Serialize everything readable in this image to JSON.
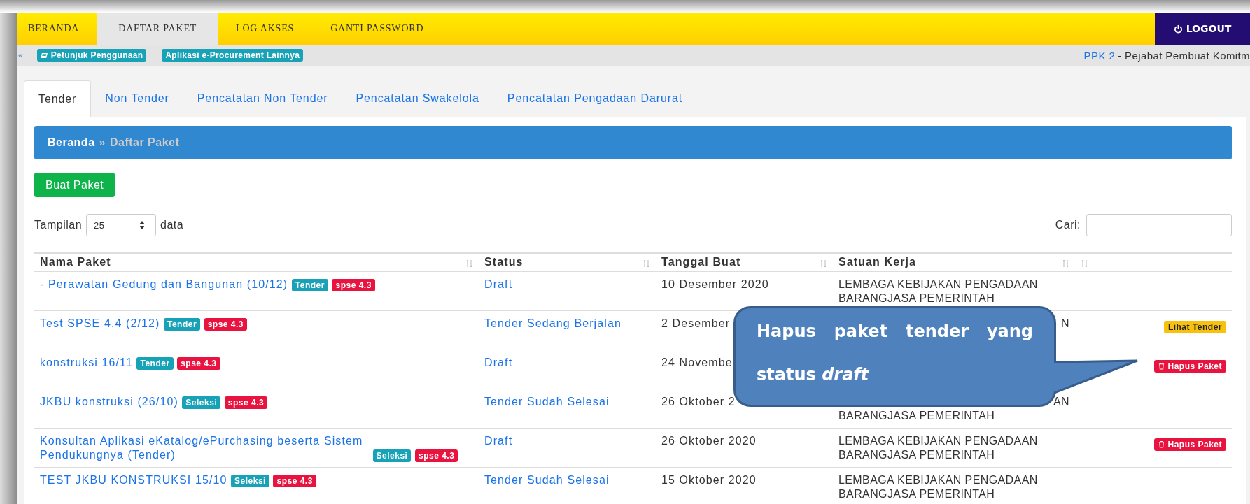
{
  "nav": {
    "items": [
      {
        "label": "BERANDA",
        "selected": false
      },
      {
        "label": "DAFTAR PAKET",
        "selected": true
      },
      {
        "label": "LOG AKSES",
        "selected": false
      },
      {
        "label": "GANTI PASSWORD",
        "selected": false
      }
    ],
    "logout": "LOGOUT"
  },
  "subbar": {
    "toggle": "«",
    "links": [
      {
        "label": "Petunjuk Penggunaan",
        "kind": "guide"
      },
      {
        "label": "Aplikasi e-Procurement Lainnya",
        "kind": "plain"
      }
    ],
    "role_link": "PPK 2",
    "role_name": "- Pejabat Pembuat Komitm"
  },
  "tabs": [
    {
      "label": "Tender",
      "selected": true
    },
    {
      "label": "Non Tender",
      "selected": false
    },
    {
      "label": "Pencatatan Non Tender",
      "selected": false
    },
    {
      "label": "Pencatatan Swakelola",
      "selected": false
    },
    {
      "label": "Pencatatan Pengadaan Darurat",
      "selected": false
    }
  ],
  "breadcrumb": {
    "home": "Beranda",
    "separator": "»",
    "current": "Daftar Paket"
  },
  "create_button": "Buat Paket",
  "page_length": {
    "label": "Tampilan",
    "value": "25",
    "suffix": "data"
  },
  "search": {
    "label": "Cari:"
  },
  "table": {
    "columns": [
      "Nama Paket",
      "Status",
      "Tanggal Buat",
      "Satuan Kerja"
    ],
    "rows": [
      {
        "name": "- Perawatan Gedung dan Bangunan (10/12)",
        "tags": [
          {
            "label": "Tender",
            "kind": "method"
          },
          {
            "label": "spse 4.3",
            "kind": "version"
          }
        ],
        "status": "Draft",
        "date": "10 Desember 2020",
        "unit": [
          {
            "text": "LEMBAGA KEBIJAKAN PENGADAAN",
            "covered": false
          },
          {
            "text": "BARANGJASA PEMERINTAH",
            "covered": false
          }
        ]
      },
      {
        "name": "Test SPSE 4.4 (2/12)",
        "tags": [
          {
            "label": "Tender",
            "kind": "method"
          },
          {
            "label": "spse 4.3",
            "kind": "version"
          }
        ],
        "status": "Tender Sedang Berjalan",
        "date": "2 Desember",
        "unit": [
          {
            "text": "N",
            "covered": true
          }
        ],
        "action": {
          "kind": "view",
          "label": "Lihat Tender"
        }
      },
      {
        "name": "konstruksi 16/11",
        "tags": [
          {
            "label": "Tender",
            "kind": "method"
          },
          {
            "label": "spse 4.3",
            "kind": "version"
          }
        ],
        "status": "Draft",
        "date": "24 Novembe",
        "unit": [],
        "action": {
          "kind": "delete",
          "label": "Hapus Paket"
        }
      },
      {
        "name": "JKBU konstruksi (26/10)",
        "tags": [
          {
            "label": "Seleksi",
            "kind": "method"
          },
          {
            "label": "spse 4.3",
            "kind": "version"
          }
        ],
        "status": "Tender Sudah Selesai",
        "date": "26 Oktober 2",
        "unit": [
          {
            "text": "AN",
            "covered": true
          },
          {
            "text": "BARANGJASA PEMERINTAH",
            "covered": false
          }
        ]
      },
      {
        "name": "Konsultan Aplikasi eKatalog/ePurchasing beserta Sistem Pendukungnya (Tender)",
        "tags": [
          {
            "label": "Seleksi",
            "kind": "method"
          },
          {
            "label": "spse 4.3",
            "kind": "version"
          }
        ],
        "status": "Draft",
        "date": "26 Oktober 2020",
        "unit": [
          {
            "text": "LEMBAGA KEBIJAKAN PENGADAAN",
            "covered": false
          },
          {
            "text": "BARANGJASA PEMERINTAH",
            "covered": false
          }
        ],
        "action": {
          "kind": "delete",
          "label": "Hapus Paket"
        }
      },
      {
        "name": "TEST JKBU KONSTRUKSI 15/10",
        "tags": [
          {
            "label": "Seleksi",
            "kind": "method"
          },
          {
            "label": "spse 4.3",
            "kind": "version"
          }
        ],
        "status": "Tender Sudah Selesai",
        "date": "15 Oktober 2020",
        "unit": [
          {
            "text": "LEMBAGA KEBIJAKAN PENGADAAN",
            "covered": false
          },
          {
            "text": "BARANGJASA PEMERINTAH",
            "covered": false
          }
        ]
      }
    ]
  },
  "callout": "Hapus paket tender yang status *draft*"
}
